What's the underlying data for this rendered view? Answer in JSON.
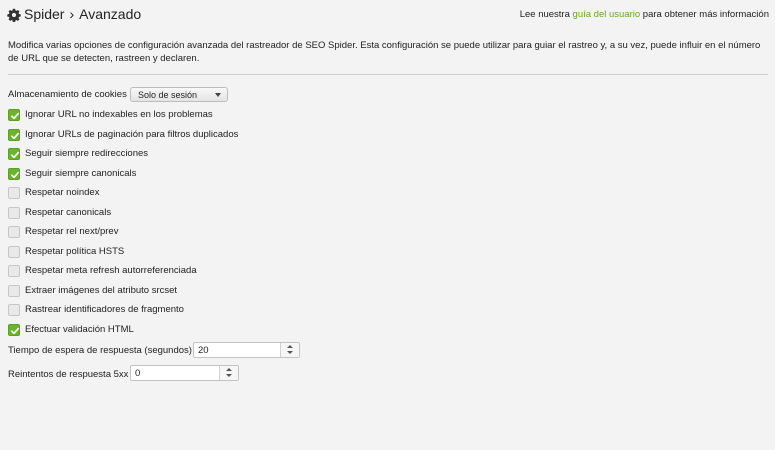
{
  "header": {
    "title_section": "Spider",
    "title_separator": "›",
    "title_page": "Avanzado",
    "help_prefix": "Lee nuestra",
    "help_link": "guía del usuario",
    "help_suffix": "para obtener más información"
  },
  "description": "Modifica varias opciones de configuración avanzada del rastreador de SEO Spider. Esta configuración se puede utilizar para guiar el rastreo y, a su vez, puede influir en el número de URL que se detecten, rastreen y declaren.",
  "cookies": {
    "label": "Almacenamiento de cookies",
    "value": "Solo de sesión"
  },
  "options": [
    {
      "label": "Ignorar URL no indexables en los problemas",
      "checked": true
    },
    {
      "label": "Ignorar URLs de paginación para filtros duplicados",
      "checked": true
    },
    {
      "label": "Seguir siempre redirecciones",
      "checked": true
    },
    {
      "label": "Seguir siempre canonicals",
      "checked": true
    },
    {
      "label": "Respetar noindex",
      "checked": false
    },
    {
      "label": "Respetar canonicals",
      "checked": false
    },
    {
      "label": "Respetar rel next/prev",
      "checked": false
    },
    {
      "label": "Respetar política HSTS",
      "checked": false
    },
    {
      "label": "Respetar meta refresh autorreferenciada",
      "checked": false
    },
    {
      "label": "Extraer imágenes del atributo srcset",
      "checked": false
    },
    {
      "label": "Rastrear identificadores de fragmento",
      "checked": false
    },
    {
      "label": "Efectuar validación HTML",
      "checked": true
    }
  ],
  "timeout": {
    "label": "Tiempo de espera de respuesta (segundos)",
    "value": "20"
  },
  "retries": {
    "label": "Reintentos de respuesta 5xx",
    "value": "0"
  },
  "colors": {
    "accent": "#6db42e",
    "link": "#6ba629",
    "background": "#f3f3f3"
  }
}
